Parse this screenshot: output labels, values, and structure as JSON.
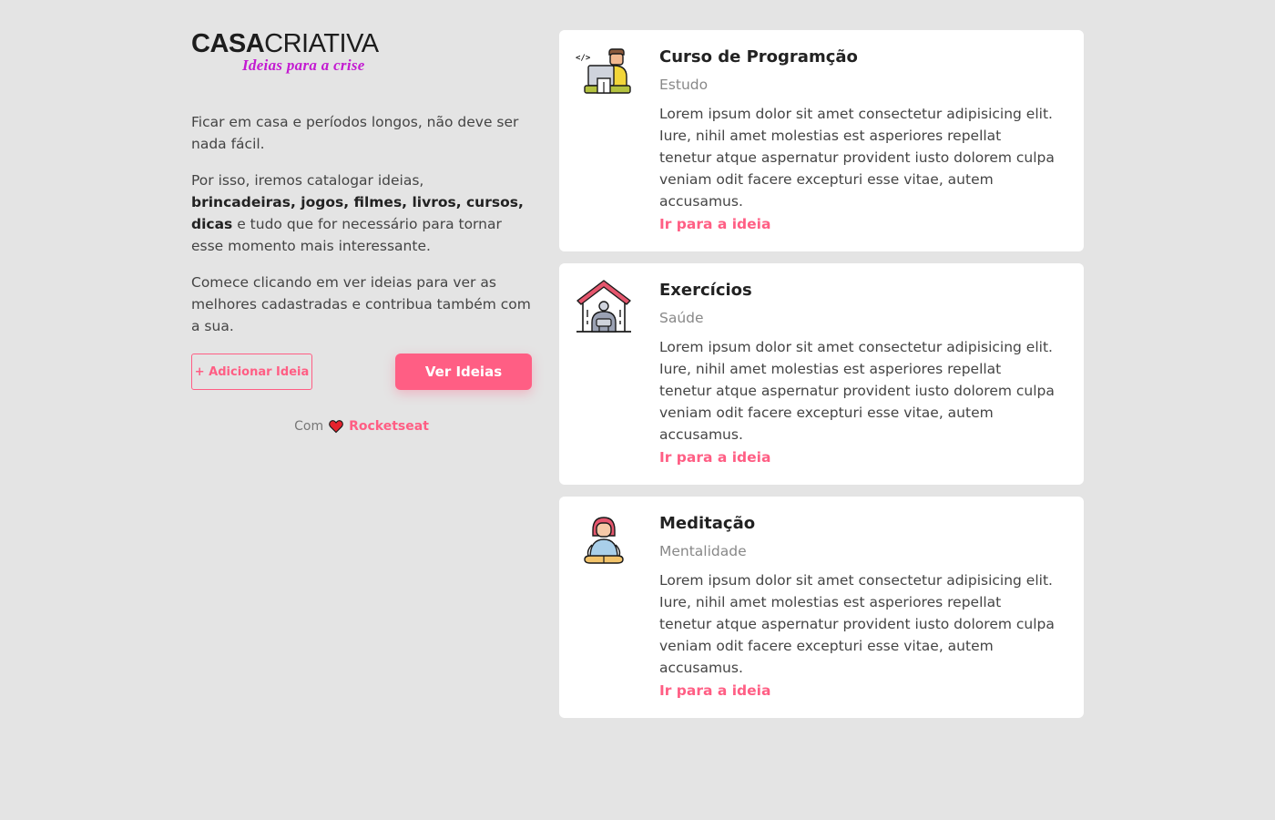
{
  "logo": {
    "main_bold": "CASA",
    "main_light": "CRIATIVA",
    "tagline": "Ideias para a crise"
  },
  "intro": {
    "p1": "Ficar em casa e períodos longos, não deve ser nada fácil.",
    "p2_before": "Por isso, iremos catalogar ideias, ",
    "p2_bold": "brincadeiras, jogos, filmes, livros, cursos, dicas",
    "p2_after": " e tudo que for necessário para tornar esse momento mais interessante.",
    "p3": "Comece clicando em ver ideias para ver as melhores cadastradas e contribua também com a sua."
  },
  "actions": {
    "add_label": "+ Adicionar Ideia",
    "view_label": "Ver Ideias"
  },
  "footer": {
    "prefix": "Com",
    "brand": "Rocketseat",
    "icon": "heart-icon"
  },
  "colors": {
    "accent": "#ff5e84",
    "background": "#e4e4e4",
    "tagline": "#c31ad1"
  },
  "ideas": [
    {
      "icon": "programmer-icon",
      "title": "Curso de Programção",
      "category": "Estudo",
      "description": "Lorem ipsum dolor sit amet consectetur adipisicing elit. Iure, nihil amet molestias est asperiores repellat tenetur atque aspernatur provident iusto dolorem culpa veniam odit facere excepturi esse vitae, autem accusamus.",
      "link": "Ir para a ideia"
    },
    {
      "icon": "home-gym-icon",
      "title": "Exercícios",
      "category": "Saúde",
      "description": "Lorem ipsum dolor sit amet consectetur adipisicing elit. Iure, nihil amet molestias est asperiores repellat tenetur atque aspernatur provident iusto dolorem culpa veniam odit facere excepturi esse vitae, autem accusamus.",
      "link": "Ir para a ideia"
    },
    {
      "icon": "meditation-icon",
      "title": "Meditação",
      "category": "Mentalidade",
      "description": "Lorem ipsum dolor sit amet consectetur adipisicing elit. Iure, nihil amet molestias est asperiores repellat tenetur atque aspernatur provident iusto dolorem culpa veniam odit facere excepturi esse vitae, autem accusamus.",
      "link": "Ir para a ideia"
    }
  ]
}
